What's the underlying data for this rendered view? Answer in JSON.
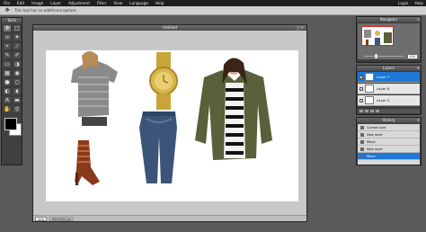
{
  "menubar": {
    "items": [
      "File",
      "Edit",
      "Image",
      "Layer",
      "Adjustment",
      "Filter",
      "View",
      "Language",
      "Help"
    ],
    "right": [
      "Login",
      "Help"
    ]
  },
  "options": {
    "tip": "This tool has no additional options"
  },
  "tools": {
    "title": "Tools"
  },
  "canvas": {
    "title": "Untitled",
    "zoom": "100",
    "dimensions": "600x500 px"
  },
  "navigator": {
    "title": "Navigator",
    "zoom_value": "100"
  },
  "layers": {
    "title": "Layers",
    "items": [
      {
        "name": "Layer 7",
        "selected": true
      },
      {
        "name": "Layer 6",
        "selected": false
      },
      {
        "name": "Layer 5",
        "selected": false
      }
    ]
  },
  "history": {
    "title": "History",
    "items": [
      {
        "label": "Canvas size",
        "selected": false
      },
      {
        "label": "New layer",
        "selected": false
      },
      {
        "label": "Move",
        "selected": false
      },
      {
        "label": "New layer",
        "selected": false
      },
      {
        "label": "Move",
        "selected": true
      }
    ]
  },
  "colors": {
    "accent": "#1e78d8",
    "foreground": "#000000",
    "background": "#ffffff"
  }
}
